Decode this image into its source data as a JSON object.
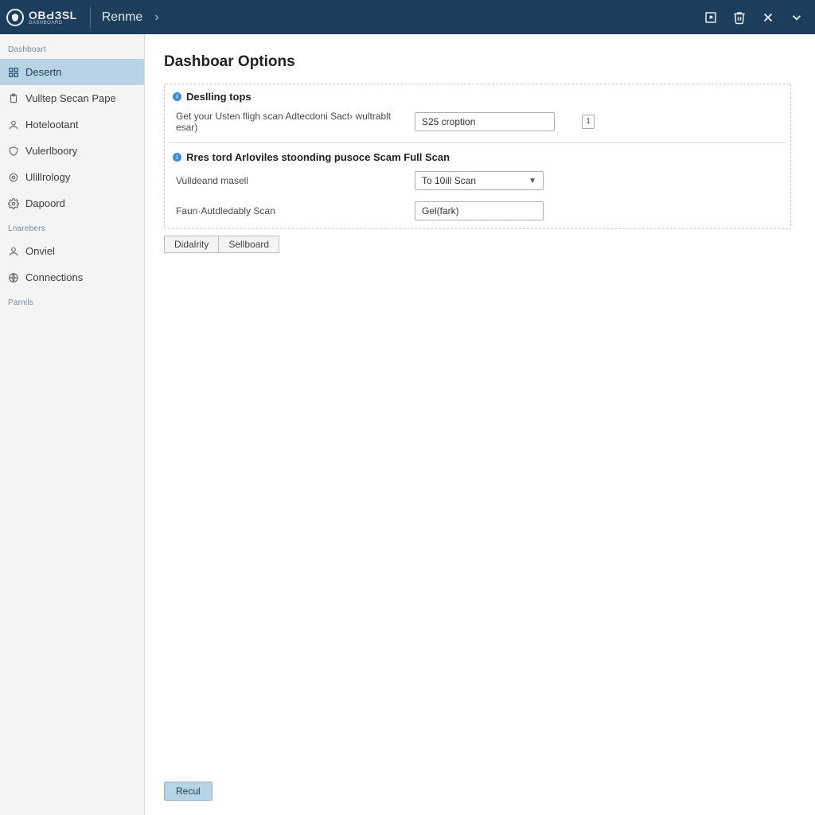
{
  "topbar": {
    "brand": "ОВԀЗSL",
    "brand_sub": "DASHBOARD",
    "crumb": "Renme"
  },
  "sidebar": {
    "group1_label": "Dashboart",
    "group2_label": "Lnarebers",
    "group3_label": "Parnils",
    "items": [
      {
        "label": "Desertn"
      },
      {
        "label": "Vulltep Secan Pape"
      },
      {
        "label": "Hotelootant"
      },
      {
        "label": "Vulerlboory"
      },
      {
        "label": "Ulillrology"
      },
      {
        "label": "Dapoord"
      }
    ],
    "items2": [
      {
        "label": "Onviel"
      },
      {
        "label": "Connections"
      }
    ]
  },
  "page": {
    "title": "Dashboar Options",
    "section1_title": "Deslling tops",
    "row1_label": "Get your Usten fligh scan Adtecdoni Sact› wultrablt esar)",
    "row1_value": "S25 croption",
    "row1_num": "1",
    "section2_title": "Rres tord Arloviles stoonding pusoce Scam Full Scan",
    "row2_label": "Vulldeand masell",
    "row2_value": "To 10ill Scan",
    "row3_label": "Faun·Autdledably Scan",
    "row3_value": "Gel(fark)",
    "btn1": "Didalrity",
    "btn2": "Sellboard",
    "footer_btn": "Recul"
  }
}
